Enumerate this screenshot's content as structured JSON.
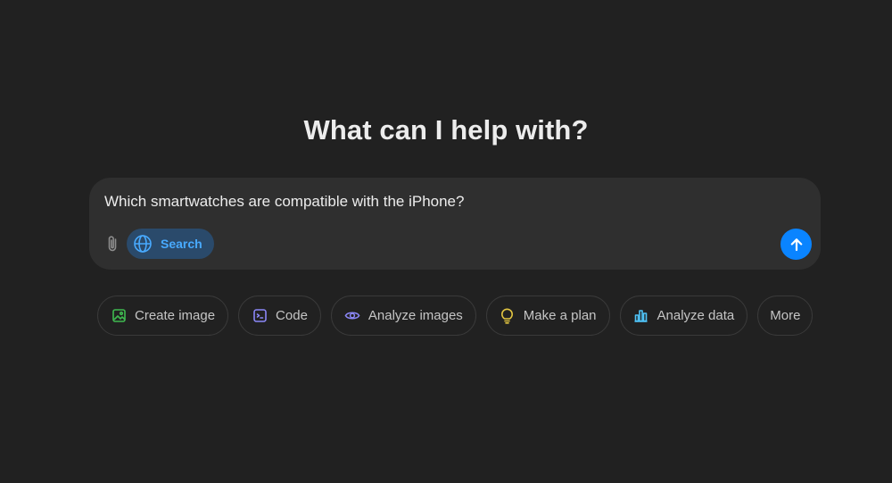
{
  "headline": "What can I help with?",
  "composer": {
    "input_value": "Which smartwatches are compatible with the iPhone?",
    "attach_icon": "paperclip-icon",
    "search_button": {
      "label": "Search",
      "icon": "globe-icon",
      "active": true
    },
    "send_icon": "arrow-up-icon"
  },
  "chips": [
    {
      "label": "Create image",
      "icon": "image-icon",
      "color": "#3fb950"
    },
    {
      "label": "Code",
      "icon": "terminal-icon",
      "color": "#8b87f7"
    },
    {
      "label": "Analyze images",
      "icon": "eye-icon",
      "color": "#8b87f7"
    },
    {
      "label": "Make a plan",
      "icon": "lightbulb-icon",
      "color": "#e2c541"
    },
    {
      "label": "Analyze data",
      "icon": "bar-chart-icon",
      "color": "#4fc3f7"
    },
    {
      "label": "More"
    }
  ],
  "colors": {
    "background": "#212121",
    "composer": "#2f2f2f",
    "accent": "#0a84ff",
    "search_pill": "#2a4a6b",
    "search_text": "#48aaff"
  }
}
